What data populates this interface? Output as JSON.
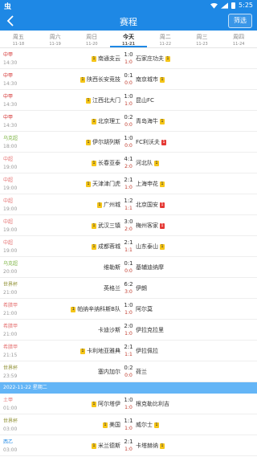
{
  "status_bar": {
    "app_glyph": "虫",
    "time": "5:25"
  },
  "header": {
    "title": "赛程",
    "filter_label": "筛选"
  },
  "day_tabs": [
    {
      "day": "周五",
      "date": "11-18"
    },
    {
      "day": "周六",
      "date": "11-19"
    },
    {
      "day": "周日",
      "date": "11-20"
    },
    {
      "day": "今天",
      "date": "11-21"
    },
    {
      "day": "周二",
      "date": "11-22"
    },
    {
      "day": "周三",
      "date": "11-23"
    },
    {
      "day": "周四",
      "date": "11-24"
    }
  ],
  "matches": [
    {
      "league": "中甲",
      "league_color": "#d32f2f",
      "time": "14:30",
      "home": "南通支云",
      "home_badge": "1",
      "score_ft": "1:0",
      "score_ht": "1:0",
      "away": "石家庄功夫",
      "away_badge": "1",
      "away_badge_type": "yellow"
    },
    {
      "league": "中甲",
      "league_color": "#d32f2f",
      "time": "14:30",
      "home": "陕西长安竞技",
      "home_badge": "1",
      "score_ft": "0:1",
      "score_ht": "0:0",
      "away": "南京城市",
      "away_badge": "1",
      "away_badge_type": "yellow"
    },
    {
      "league": "中甲",
      "league_color": "#d32f2f",
      "time": "14:30",
      "home": "江西北大门",
      "home_badge": "1",
      "score_ft": "1:0",
      "score_ht": "1:0",
      "away": "昆山FC",
      "away_badge": "",
      "away_badge_type": ""
    },
    {
      "league": "中甲",
      "league_color": "#d32f2f",
      "time": "14:30",
      "home": "北京理工",
      "home_badge": "1",
      "score_ft": "0:2",
      "score_ht": "0:0",
      "away": "青岛海牛",
      "away_badge": "1",
      "away_badge_type": "yellow"
    },
    {
      "league": "乌克超",
      "league_color": "#7cb342",
      "time": "18:00",
      "home": "伊尔胡列斯",
      "home_badge": "1",
      "score_ft": "1:0",
      "score_ht": "0:0",
      "away": "FC利沃夫",
      "away_badge": "1",
      "away_badge_type": "red"
    },
    {
      "league": "中超",
      "league_color": "#e57373",
      "time": "19:00",
      "home": "长春亚泰",
      "home_badge": "1",
      "score_ft": "4:1",
      "score_ht": "2:0",
      "away": "河北队",
      "away_badge": "1",
      "away_badge_type": "yellow"
    },
    {
      "league": "中超",
      "league_color": "#e57373",
      "time": "19:00",
      "home": "天津津门虎",
      "home_badge": "1",
      "score_ft": "2:1",
      "score_ht": "1:0",
      "away": "上海申花",
      "away_badge": "1",
      "away_badge_type": "yellow"
    },
    {
      "league": "中超",
      "league_color": "#e57373",
      "time": "19:00",
      "home": "广州城",
      "home_badge": "1",
      "score_ft": "1:2",
      "score_ht": "1:1",
      "away": "北京国安",
      "away_badge": "1",
      "away_badge_type": "red"
    },
    {
      "league": "中超",
      "league_color": "#e57373",
      "time": "19:00",
      "home": "武汉三镇",
      "home_badge": "1",
      "score_ft": "3:0",
      "score_ht": "2:0",
      "away": "梅州客家",
      "away_badge": "1",
      "away_badge_type": "red"
    },
    {
      "league": "中超",
      "league_color": "#e57373",
      "time": "19:00",
      "home": "成都蓉城",
      "home_badge": "1",
      "score_ft": "2:1",
      "score_ht": "1:1",
      "away": "山东泰山",
      "away_badge": "1",
      "away_badge_type": "yellow"
    },
    {
      "league": "乌克超",
      "league_color": "#7cb342",
      "time": "20:00",
      "home": "维勒斯",
      "home_badge": "",
      "score_ft": "0:1",
      "score_ht": "0:0",
      "away": "基辅迪纳摩",
      "away_badge": "",
      "away_badge_type": ""
    },
    {
      "league": "世界杯",
      "league_color": "#8e8e2f",
      "time": "21:00",
      "home": "英格兰",
      "home_badge": "",
      "score_ft": "6:2",
      "score_ht": "3:0",
      "away": "伊朗",
      "away_badge": "",
      "away_badge_type": ""
    },
    {
      "league": "希腊甲",
      "league_color": "#e57373",
      "time": "21:00",
      "home": "帕纳辛纳科斯B队",
      "home_badge": "1",
      "score_ft": "1:0",
      "score_ht": "1:0",
      "away": "阿尔莫",
      "away_badge": "",
      "away_badge_type": ""
    },
    {
      "league": "希腊甲",
      "league_color": "#e57373",
      "time": "21:00",
      "home": "卡迪沙斯",
      "home_badge": "",
      "score_ft": "2:0",
      "score_ht": "1:0",
      "away": "伊拉克拉里",
      "away_badge": "",
      "away_badge_type": ""
    },
    {
      "league": "希腊甲",
      "league_color": "#e57373",
      "time": "21:15",
      "home": "卡利地亚雅典",
      "home_badge": "1",
      "score_ft": "2:1",
      "score_ht": "1:1",
      "away": "伊拉佩拉",
      "away_badge": "",
      "away_badge_type": ""
    },
    {
      "league": "世界杯",
      "league_color": "#8e8e2f",
      "time": "23:59",
      "home": "塞内加尔",
      "home_badge": "",
      "score_ft": "0:2",
      "score_ht": "0:0",
      "away": "荷兰",
      "away_badge": "",
      "away_badge_type": ""
    }
  ],
  "section_header": "2022-11-22 星期二",
  "matches_next": [
    {
      "league": "土甲",
      "league_color": "#e57373",
      "time": "01:00",
      "home": "阿尔塔伊",
      "home_badge": "1",
      "score_ft": "1:0",
      "score_ht": "1:0",
      "away": "根克勒比利吉",
      "away_badge": "",
      "away_badge_type": ""
    },
    {
      "league": "世界杯",
      "league_color": "#8e8e2f",
      "time": "03:00",
      "home": "美国",
      "home_badge": "1",
      "score_ft": "1:1",
      "score_ht": "1:0",
      "away": "威尔士",
      "away_badge": "1",
      "away_badge_type": "yellow"
    },
    {
      "league": "西乙",
      "league_color": "#1e88e5",
      "time": "03:00",
      "home": "米兰德斯",
      "home_badge": "1",
      "score_ft": "2:1",
      "score_ht": "1:0",
      "away": "卡塔赫纳",
      "away_badge": "1",
      "away_badge_type": "yellow"
    }
  ]
}
